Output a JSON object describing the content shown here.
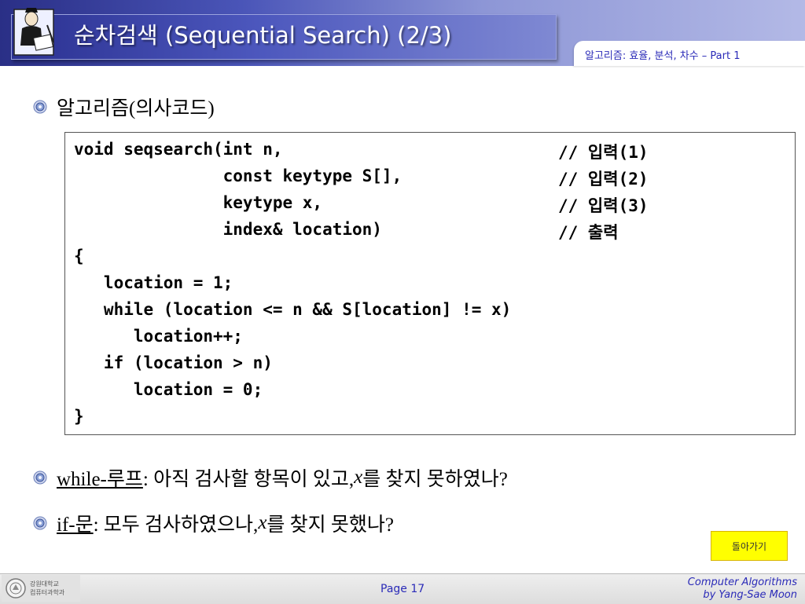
{
  "header": {
    "title": "순차검색 (Sequential Search) (2/3)",
    "subtitle_prefix": "알고리즘: 효율, 분석, 차수 – ",
    "subtitle_part": "Part 1"
  },
  "bullets": [
    {
      "text": "알고리즘(의사코드)"
    },
    {
      "keyword": "while-루프",
      "rest_before": ": 아직 검사할 항목이 있고, ",
      "var": "x",
      "rest_after": "를 찾지 못하였나?"
    },
    {
      "keyword": "if-문",
      "rest_before": ": 모두 검사하였으나, ",
      "var": "x",
      "rest_after": "를 찾지 못했나?"
    }
  ],
  "code": {
    "lines": [
      "void seqsearch(int n,",
      "               const keytype S[],",
      "               keytype x,",
      "               index& location)",
      "{",
      "   location = 1;",
      "   while (location <= n && S[location] != x)",
      "      location++;",
      "   if (location > n)",
      "      location = 0;",
      "}"
    ],
    "comments": [
      "// 입력(1)",
      "// 입력(2)",
      "// 입력(3)",
      "// 출력"
    ]
  },
  "back_button": {
    "label": "돌아가기"
  },
  "footer": {
    "logo_line1": "강원대학교",
    "logo_line2": "컴퓨터과학과",
    "page_label": "Page 17",
    "credit_line1": "Computer Algorithms",
    "credit_line2": "by Yang-Sae Moon"
  }
}
